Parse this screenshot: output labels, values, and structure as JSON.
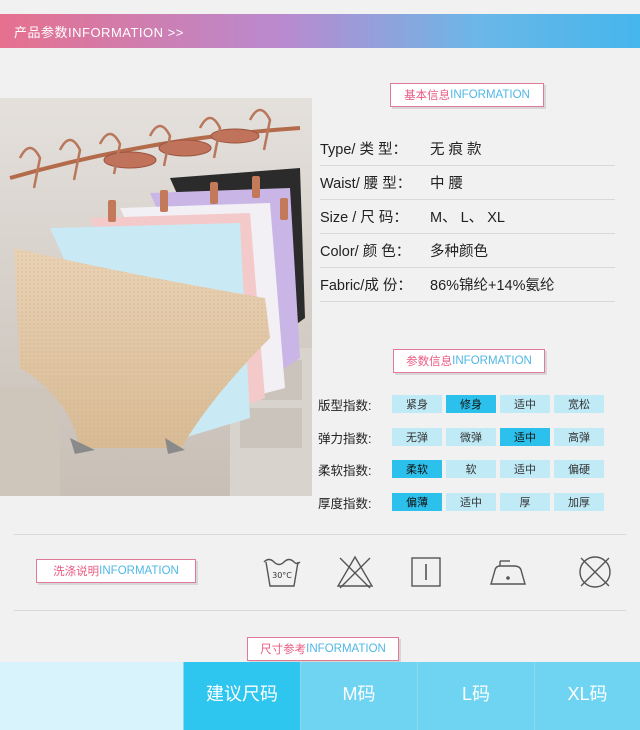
{
  "header": {
    "title": "产品参数INFORMATION  >>"
  },
  "basic_info": {
    "tag_cn": "基本信息",
    "tag_en": "INFORMATION",
    "rows": [
      {
        "key": "Type/ 类 型：",
        "value": "无 痕 款"
      },
      {
        "key": "Waist/ 腰 型：",
        "value": "中   腰"
      },
      {
        "key": "Size / 尺 码：",
        "value": "M、 L、 XL"
      },
      {
        "key": "Color/ 颜 色：",
        "value": "多种颜色"
      },
      {
        "key": "Fabric/成 份：",
        "value": "86%锦纶+14%氨纶"
      }
    ]
  },
  "params": {
    "tag_cn": "参数信息",
    "tag_en": "INFORMATION",
    "rows": [
      {
        "label": "版型指数:",
        "options": [
          "紧身",
          "修身",
          "适中",
          "宽松"
        ],
        "selected": 1
      },
      {
        "label": "弹力指数:",
        "options": [
          "无弹",
          "微弹",
          "适中",
          "高弹"
        ],
        "selected": 2
      },
      {
        "label": "柔软指数:",
        "options": [
          "柔软",
          "软",
          "适中",
          "偏硬"
        ],
        "selected": 0
      },
      {
        "label": "厚度指数:",
        "options": [
          "偏薄",
          "适中",
          "厚",
          "加厚"
        ],
        "selected": 0
      }
    ]
  },
  "wash": {
    "tag_cn": "洗涤说明",
    "tag_en": "INFORMATION",
    "icons": [
      "wash-30-icon",
      "no-bleach-icon",
      "line-dry-icon",
      "iron-low-icon",
      "no-dryclean-icon"
    ],
    "temp_label": "30°C"
  },
  "size_ref": {
    "tag_cn": "尺寸参考",
    "tag_en": "INFORMATION",
    "headers": [
      "建议尺码",
      "M码",
      "L码",
      "XL码"
    ]
  },
  "colors": {
    "accent_pink": "#ea5a83",
    "accent_blue": "#2cc1ec",
    "cell_light": "#bfeaf6"
  }
}
